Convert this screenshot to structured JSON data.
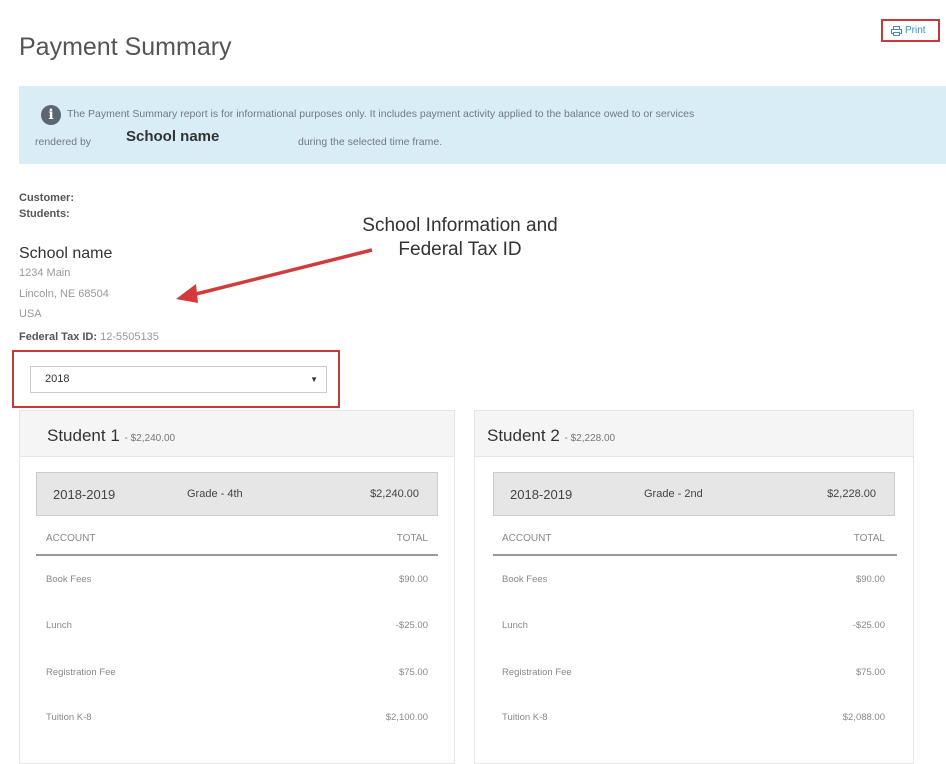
{
  "page": {
    "title": "Payment Summary",
    "print_label": "Print"
  },
  "info": {
    "line1": "The Payment Summary report is for informational purposes only. It includes payment activity applied to the balance owed to or services",
    "line2_prefix": "rendered by",
    "school_placeholder": "School name",
    "line2_suffix": "during the selected time frame."
  },
  "customer": {
    "customer_label": "Customer:",
    "students_label": "Students:"
  },
  "school": {
    "name": "School name",
    "address1": "1234 Main",
    "address2": "Lincoln, NE 68504",
    "country": "USA",
    "tax_label": "Federal Tax ID:",
    "tax_id": "12-5505135"
  },
  "annotation": {
    "line1": "School Information and",
    "line2": "Federal Tax ID"
  },
  "filter": {
    "selected_year": "2018"
  },
  "students": [
    {
      "name": "Student 1",
      "total": "- $2,240.00",
      "school_year": "2018-2019",
      "grade": "Grade - 4th",
      "year_total": "$2,240.00",
      "account_header": "ACCOUNT",
      "total_header": "TOTAL",
      "rows": [
        {
          "account": "Book Fees",
          "total": "$90.00"
        },
        {
          "account": "Lunch",
          "total": "-$25.00"
        },
        {
          "account": "Registration Fee",
          "total": "$75.00"
        },
        {
          "account": "Tuition K-8",
          "total": "$2,100.00"
        }
      ]
    },
    {
      "name": "Student 2",
      "total": "- $2,228.00",
      "school_year": "2018-2019",
      "grade": "Grade - 2nd",
      "year_total": "$2,228.00",
      "account_header": "ACCOUNT",
      "total_header": "TOTAL",
      "rows": [
        {
          "account": "Book Fees",
          "total": "$90.00"
        },
        {
          "account": "Lunch",
          "total": "-$25.00"
        },
        {
          "account": "Registration Fee",
          "total": "$75.00"
        },
        {
          "account": "Tuition K-8",
          "total": "$2,088.00"
        }
      ]
    }
  ],
  "colors": {
    "highlight": "#c9383d",
    "info_bg": "#d9edf7",
    "link": "#3c8fc6"
  },
  "icons": {
    "print": "printer-icon",
    "info": "info-icon",
    "select": "chevron-down-icon"
  }
}
